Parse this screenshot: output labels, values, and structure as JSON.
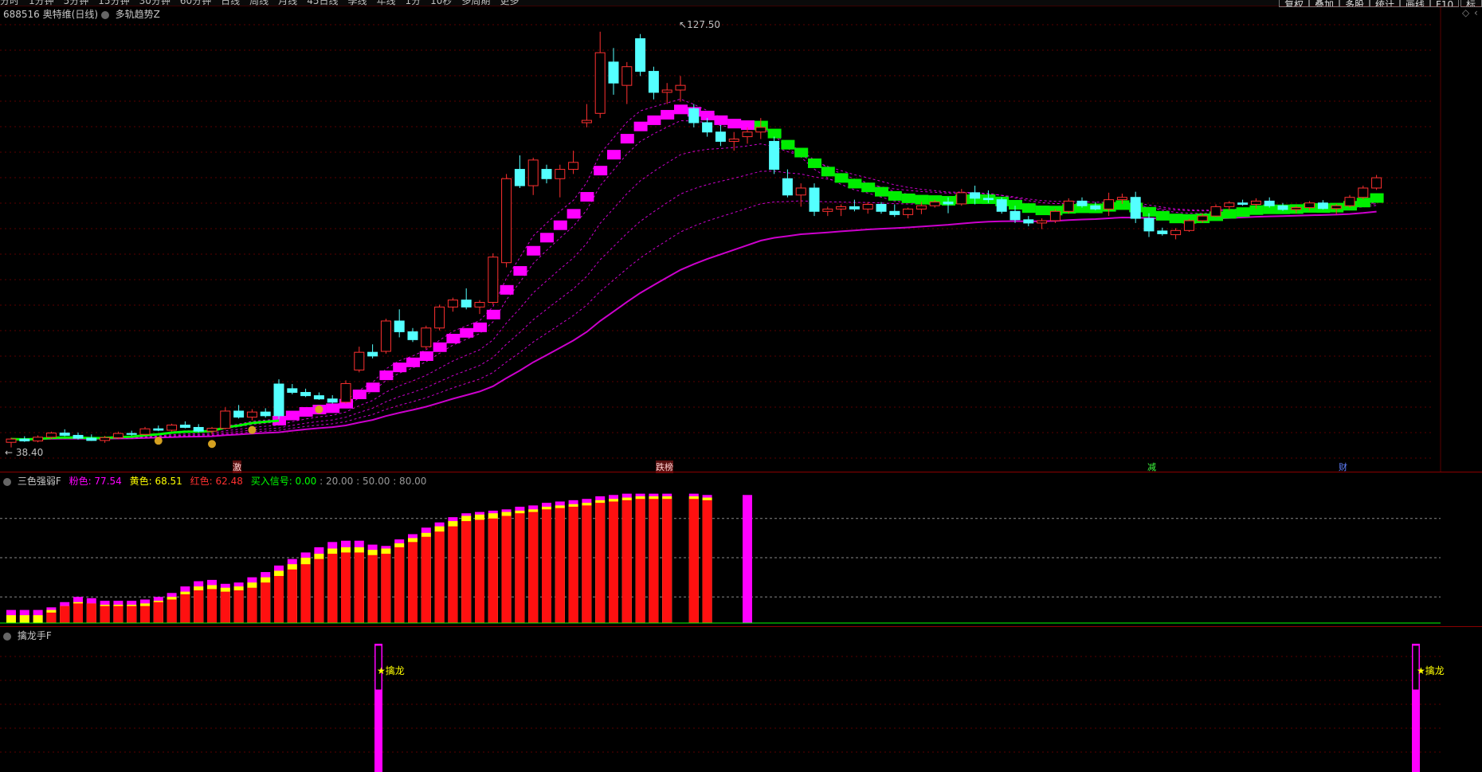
{
  "menu": [
    "分时",
    "1分钟",
    "5分钟",
    "15分钟",
    "30分钟",
    "60分钟",
    "日线",
    "周线",
    "月线",
    "45日线",
    "季线",
    "年线",
    "1分",
    "10秒",
    "多周期",
    "更多"
  ],
  "right_buttons": [
    "复权",
    "叠加",
    "多股",
    "统计",
    "画线",
    "F10",
    "标记"
  ],
  "main_pane": {
    "stock_code": "688516",
    "stock_name": "奥特维(日线)",
    "indicator": "多轨趋势Z",
    "high_label": "127.50",
    "low_label": "38.40"
  },
  "event_tags": [
    "激",
    "跌榜",
    "减",
    "财"
  ],
  "indicator_pane_1": {
    "name": "三色强弱F",
    "pink_label": "粉色: 77.54",
    "yellow_label": "黄色: 68.51",
    "red_label": "红色: 62.48",
    "signal_label": "买入信号: 0.00",
    "levels": [
      ": 20.00",
      ": 50.00",
      ": 80.00"
    ]
  },
  "indicator_pane_2": {
    "name": "擒龙手F",
    "signal_text": "擒龙"
  },
  "colors": {
    "up": "#ff3030",
    "down": "#54ffff",
    "pink": "#ff00ff",
    "yellow": "#ffff00",
    "green": "#00ff00",
    "grid": "#5a0000"
  },
  "chart_data": [
    {
      "type": "candlestick",
      "title": "688516 奥特维(日线)",
      "series": [
        {
          "name": "price",
          "values": [
            {
              "o": 39.5,
              "h": 40.5,
              "l": 38.4,
              "c": 40.2
            },
            {
              "o": 40.2,
              "h": 40.8,
              "l": 39.6,
              "c": 39.8
            },
            {
              "o": 39.8,
              "h": 41,
              "l": 39.5,
              "c": 40.6
            },
            {
              "o": 40.6,
              "h": 41.8,
              "l": 40.2,
              "c": 41.5
            },
            {
              "o": 41.5,
              "h": 42.3,
              "l": 40.8,
              "c": 41.0
            },
            {
              "o": 41.0,
              "h": 41.6,
              "l": 40.1,
              "c": 40.4
            },
            {
              "o": 40.4,
              "h": 41.2,
              "l": 39.8,
              "c": 39.9
            },
            {
              "o": 39.9,
              "h": 40.9,
              "l": 39.4,
              "c": 40.5
            },
            {
              "o": 40.5,
              "h": 41.8,
              "l": 40.2,
              "c": 41.4
            },
            {
              "o": 41.4,
              "h": 42.0,
              "l": 40.9,
              "c": 41.2
            },
            {
              "o": 41.2,
              "h": 42.8,
              "l": 41.0,
              "c": 42.4
            },
            {
              "o": 42.4,
              "h": 43.1,
              "l": 41.9,
              "c": 42.1
            },
            {
              "o": 42.1,
              "h": 43.5,
              "l": 41.8,
              "c": 43.2
            },
            {
              "o": 43.2,
              "h": 44.0,
              "l": 42.5,
              "c": 42.7
            },
            {
              "o": 42.7,
              "h": 43.4,
              "l": 41.6,
              "c": 41.9
            },
            {
              "o": 41.9,
              "h": 42.8,
              "l": 41.2,
              "c": 42.5
            },
            {
              "o": 42.5,
              "h": 47,
              "l": 42.3,
              "c": 46.2
            },
            {
              "o": 46.2,
              "h": 47.5,
              "l": 44.6,
              "c": 44.9
            },
            {
              "o": 44.9,
              "h": 46.6,
              "l": 44.2,
              "c": 46.0
            },
            {
              "o": 46.0,
              "h": 46.8,
              "l": 44.8,
              "c": 45.2
            },
            {
              "o": 52,
              "h": 53,
              "l": 44.5,
              "c": 45.2
            },
            {
              "o": 51,
              "h": 52,
              "l": 49.8,
              "c": 50.2
            },
            {
              "o": 50.2,
              "h": 51,
              "l": 49.2,
              "c": 49.5
            },
            {
              "o": 49.5,
              "h": 50.2,
              "l": 48.6,
              "c": 48.8
            },
            {
              "o": 48.8,
              "h": 49.6,
              "l": 47.8,
              "c": 48.1
            },
            {
              "o": 48.1,
              "h": 52.8,
              "l": 47.8,
              "c": 52.1
            },
            {
              "o": 55,
              "h": 60,
              "l": 54.5,
              "c": 58.8
            },
            {
              "o": 58.8,
              "h": 60.5,
              "l": 57.5,
              "c": 58.0
            },
            {
              "o": 59,
              "h": 66,
              "l": 58.5,
              "c": 65.5
            },
            {
              "o": 65.5,
              "h": 68,
              "l": 62,
              "c": 63.2
            },
            {
              "o": 63.2,
              "h": 64,
              "l": 61,
              "c": 61.5
            },
            {
              "o": 60,
              "h": 64.5,
              "l": 59.5,
              "c": 64.0
            },
            {
              "o": 64,
              "h": 69,
              "l": 63.5,
              "c": 68.5
            },
            {
              "o": 68.5,
              "h": 70.5,
              "l": 67.5,
              "c": 70.0
            },
            {
              "o": 70,
              "h": 72.5,
              "l": 68,
              "c": 68.5
            },
            {
              "o": 68.5,
              "h": 70,
              "l": 67,
              "c": 69.5
            },
            {
              "o": 69.5,
              "h": 80,
              "l": 69,
              "c": 79.2
            },
            {
              "o": 78,
              "h": 97,
              "l": 77,
              "c": 96
            },
            {
              "o": 98,
              "h": 101,
              "l": 94,
              "c": 94.5
            },
            {
              "o": 94.5,
              "h": 100.5,
              "l": 92.5,
              "c": 100
            },
            {
              "o": 98,
              "h": 99,
              "l": 95,
              "c": 96
            },
            {
              "o": 96,
              "h": 99,
              "l": 92,
              "c": 98
            },
            {
              "o": 98,
              "h": 102,
              "l": 97,
              "c": 99.5
            },
            {
              "o": 108,
              "h": 112,
              "l": 107,
              "c": 108.5
            },
            {
              "o": 110,
              "h": 127.5,
              "l": 109,
              "c": 123
            },
            {
              "o": 121,
              "h": 124,
              "l": 114,
              "c": 116.5
            },
            {
              "o": 116,
              "h": 121,
              "l": 112,
              "c": 120
            },
            {
              "o": 126,
              "h": 127,
              "l": 118,
              "c": 119
            },
            {
              "o": 119,
              "h": 120,
              "l": 113,
              "c": 114.5
            },
            {
              "o": 114.5,
              "h": 116.5,
              "l": 112,
              "c": 115
            },
            {
              "o": 115,
              "h": 118,
              "l": 112.5,
              "c": 116
            },
            {
              "o": 111,
              "h": 112,
              "l": 107,
              "c": 108
            },
            {
              "o": 108,
              "h": 109,
              "l": 105,
              "c": 106
            },
            {
              "o": 106,
              "h": 107.5,
              "l": 103,
              "c": 104
            },
            {
              "o": 104,
              "h": 106,
              "l": 102,
              "c": 104.5
            },
            {
              "o": 105,
              "h": 107,
              "l": 103.5,
              "c": 106
            },
            {
              "o": 106,
              "h": 109,
              "l": 104.5,
              "c": 107
            },
            {
              "o": 104,
              "h": 105,
              "l": 97,
              "c": 98
            },
            {
              "o": 96,
              "h": 98,
              "l": 92,
              "c": 92.5
            },
            {
              "o": 92.5,
              "h": 95,
              "l": 90,
              "c": 94
            },
            {
              "o": 94,
              "h": 95,
              "l": 88,
              "c": 89
            },
            {
              "o": 89,
              "h": 90,
              "l": 88,
              "c": 89.5
            },
            {
              "o": 89.5,
              "h": 90.5,
              "l": 88,
              "c": 90
            },
            {
              "o": 90,
              "h": 91.5,
              "l": 89,
              "c": 89.5
            },
            {
              "o": 89.5,
              "h": 91,
              "l": 88.5,
              "c": 90.5
            },
            {
              "o": 90.5,
              "h": 91,
              "l": 88.5,
              "c": 89
            },
            {
              "o": 89,
              "h": 90.5,
              "l": 87.8,
              "c": 88.3
            },
            {
              "o": 88.3,
              "h": 89.8,
              "l": 87.5,
              "c": 89.5
            },
            {
              "o": 89.5,
              "h": 91,
              "l": 88.4,
              "c": 90.2
            },
            {
              "o": 90.2,
              "h": 91.5,
              "l": 89.8,
              "c": 91.0
            },
            {
              "o": 91,
              "h": 92,
              "l": 88.6,
              "c": 90.6
            },
            {
              "o": 90.6,
              "h": 93.8,
              "l": 90.2,
              "c": 93
            },
            {
              "o": 93,
              "h": 94.5,
              "l": 90.5,
              "c": 91.8
            },
            {
              "o": 91.8,
              "h": 93.5,
              "l": 90.8,
              "c": 91.5
            },
            {
              "o": 91.5,
              "h": 92,
              "l": 88.5,
              "c": 89
            },
            {
              "o": 89,
              "h": 90.2,
              "l": 86.5,
              "c": 87.2
            },
            {
              "o": 87.2,
              "h": 88,
              "l": 85.8,
              "c": 86.5
            },
            {
              "o": 86.5,
              "h": 87.5,
              "l": 85.2,
              "c": 87
            },
            {
              "o": 87,
              "h": 89.5,
              "l": 86.5,
              "c": 89
            },
            {
              "o": 89,
              "h": 91.8,
              "l": 88.5,
              "c": 91.2
            },
            {
              "o": 91.2,
              "h": 92,
              "l": 89.8,
              "c": 90.2
            },
            {
              "o": 90.2,
              "h": 91,
              "l": 89.2,
              "c": 89.5
            },
            {
              "o": 89.5,
              "h": 93,
              "l": 88,
              "c": 91.5
            },
            {
              "o": 91.5,
              "h": 92.8,
              "l": 90.6,
              "c": 92
            },
            {
              "o": 92,
              "h": 93.2,
              "l": 86.5,
              "c": 87.5
            },
            {
              "o": 87.5,
              "h": 88.6,
              "l": 83.5,
              "c": 84.8
            },
            {
              "o": 84.8,
              "h": 85.5,
              "l": 83.8,
              "c": 84.2
            },
            {
              "o": 84,
              "h": 85.4,
              "l": 83,
              "c": 84.9
            },
            {
              "o": 84.9,
              "h": 87.4,
              "l": 84.6,
              "c": 87
            },
            {
              "o": 87,
              "h": 88.6,
              "l": 86.5,
              "c": 88
            },
            {
              "o": 88,
              "h": 90.5,
              "l": 87.8,
              "c": 90
            },
            {
              "o": 90,
              "h": 91.2,
              "l": 89.2,
              "c": 90.8
            },
            {
              "o": 90.8,
              "h": 91.5,
              "l": 90.2,
              "c": 90.5
            },
            {
              "o": 90.5,
              "h": 91.8,
              "l": 89.6,
              "c": 91.2
            },
            {
              "o": 91.2,
              "h": 92,
              "l": 89.8,
              "c": 90.2
            },
            {
              "o": 90.2,
              "h": 90.8,
              "l": 89.1,
              "c": 89.4
            },
            {
              "o": 89.4,
              "h": 90.2,
              "l": 88.6,
              "c": 89.8
            },
            {
              "o": 89.8,
              "h": 91.2,
              "l": 89.2,
              "c": 90.8
            },
            {
              "o": 90.8,
              "h": 91.4,
              "l": 89.4,
              "c": 89.6
            },
            {
              "o": 89.6,
              "h": 90.6,
              "l": 88.4,
              "c": 90.2
            },
            {
              "o": 90.2,
              "h": 92.5,
              "l": 89.8,
              "c": 92
            },
            {
              "o": 92,
              "h": 94.5,
              "l": 91.6,
              "c": 94
            },
            {
              "o": 94,
              "h": 96.8,
              "l": 93.6,
              "c": 96.2
            }
          ]
        }
      ],
      "ylim": [
        38,
        129
      ]
    },
    {
      "type": "bar",
      "title": "三色强弱F",
      "series": [
        {
          "name": "粉色",
          "values": [
            10,
            10,
            10,
            12,
            16,
            20,
            19,
            17,
            17,
            17,
            18,
            20,
            23,
            28,
            32,
            33,
            30,
            31,
            35,
            39,
            44,
            49,
            54,
            58,
            62,
            63,
            63,
            60,
            59,
            64,
            68,
            73,
            77,
            81,
            84,
            85,
            86,
            87,
            89,
            90,
            92,
            93,
            94,
            95,
            97,
            98,
            99,
            99,
            99,
            99,
            0,
            99,
            98,
            0,
            0,
            98
          ]
        },
        {
          "name": "黄色",
          "values": [
            6,
            6,
            6,
            10,
            13,
            16,
            15,
            14,
            14,
            14,
            15,
            17,
            20,
            24,
            28,
            29,
            27,
            28,
            31,
            35,
            40,
            45,
            50,
            53,
            57,
            58,
            58,
            56,
            57,
            61,
            65,
            69,
            74,
            78,
            82,
            83,
            84,
            85,
            86,
            87,
            89,
            90,
            91,
            92,
            94,
            95,
            96,
            97,
            97,
            97,
            0,
            97,
            96,
            0,
            0,
            0
          ]
        },
        {
          "name": "红色",
          "values": [
            0,
            0,
            0,
            8,
            13,
            15,
            15,
            13,
            13,
            13,
            13,
            16,
            18,
            22,
            25,
            26,
            24,
            25,
            27,
            31,
            36,
            41,
            45,
            49,
            53,
            54,
            54,
            52,
            53,
            58,
            62,
            66,
            70,
            74,
            78,
            79,
            80,
            82,
            84,
            85,
            87,
            88,
            89,
            90,
            92,
            93,
            94,
            95,
            95,
            95,
            0,
            95,
            94,
            0,
            0,
            0
          ]
        }
      ],
      "levels": [
        20,
        50,
        80
      ],
      "ylim": [
        0,
        100
      ]
    }
  ]
}
